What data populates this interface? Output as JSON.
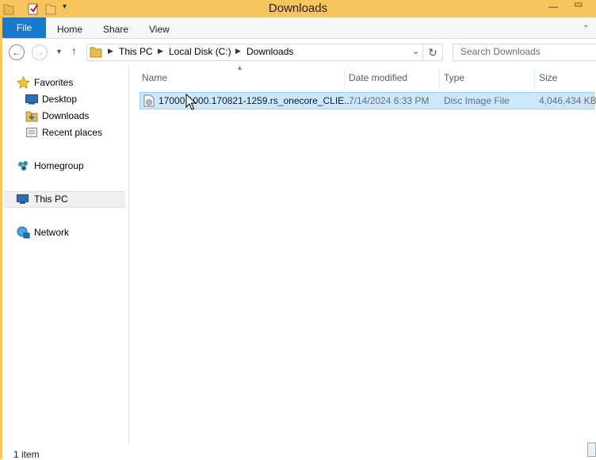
{
  "window": {
    "title": "Downloads",
    "colors": {
      "titlebar": "#f7c55d",
      "file_tab": "#1979ca",
      "selection": "#cce8ff"
    }
  },
  "ribbon": {
    "file_label": "File",
    "tabs": [
      "Home",
      "Share",
      "View"
    ]
  },
  "address": {
    "crumbs": [
      "This PC",
      "Local Disk (C:)",
      "Downloads"
    ]
  },
  "search": {
    "placeholder": "Search Downloads"
  },
  "nav": {
    "favorites": {
      "label": "Favorites",
      "icon": "star-icon"
    },
    "favorite_items": [
      {
        "label": "Desktop",
        "icon": "desktop-icon"
      },
      {
        "label": "Downloads",
        "icon": "downloads-folder-icon"
      },
      {
        "label": "Recent places",
        "icon": "recent-places-icon"
      }
    ],
    "homegroup": {
      "label": "Homegroup",
      "icon": "homegroup-icon"
    },
    "this_pc": {
      "label": "This PC",
      "icon": "computer-icon"
    },
    "network": {
      "label": "Network",
      "icon": "network-icon"
    }
  },
  "columns": [
    "Name",
    "Date modified",
    "Type",
    "Size"
  ],
  "files": [
    {
      "name": "17000.1000.170821-1259.rs_onecore_CLIE...",
      "date_modified": "7/14/2024 6:33 PM",
      "type": "Disc Image File",
      "size": "4,046,434 KB",
      "icon": "disc-image-file-icon"
    }
  ],
  "status": {
    "item_count": "1 item"
  }
}
